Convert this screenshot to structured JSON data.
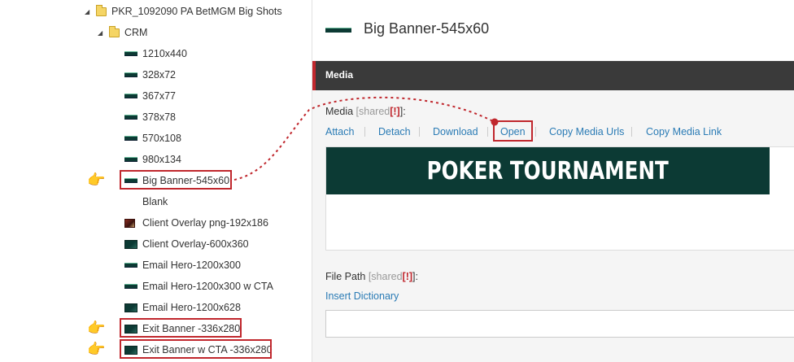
{
  "tree": {
    "root_folder": "PKR_1092090 PA BetMGM Big Shots",
    "sub_folder": "CRM",
    "items": [
      {
        "label": "1210x440",
        "thumb": "strip"
      },
      {
        "label": "328x72",
        "thumb": "strip"
      },
      {
        "label": "367x77",
        "thumb": "strip"
      },
      {
        "label": "378x78",
        "thumb": "strip"
      },
      {
        "label": "570x108",
        "thumb": "strip"
      },
      {
        "label": "980x134",
        "thumb": "strip"
      },
      {
        "label": "Big Banner-545x60",
        "thumb": "strip",
        "highlighted": true
      },
      {
        "label": "Blank",
        "thumb": "none"
      },
      {
        "label": "Client Overlay png-192x186",
        "thumb": "photo"
      },
      {
        "label": "Client Overlay-600x360",
        "thumb": "big"
      },
      {
        "label": "Email Hero-1200x300",
        "thumb": "strip"
      },
      {
        "label": "Email Hero-1200x300 w CTA",
        "thumb": "strip"
      },
      {
        "label": "Email Hero-1200x628",
        "thumb": "big"
      },
      {
        "label": "Exit Banner -336x280",
        "thumb": "big",
        "highlighted": true
      },
      {
        "label": "Exit Banner w CTA -336x280",
        "thumb": "big",
        "highlighted": true
      }
    ]
  },
  "header": {
    "title": "Big Banner-545x60"
  },
  "section": {
    "title": "Media"
  },
  "media_field": {
    "label": "Media",
    "shared": "[shared",
    "bang": "[!]",
    "close": "]:",
    "actions": [
      "Attach",
      "Detach",
      "Download",
      "Open",
      "Copy Media Urls",
      "Copy Media Link"
    ],
    "banner_text": "POKER TOURNAMENT"
  },
  "filepath_field": {
    "label": "File Path",
    "shared": "[shared",
    "bang": "[!]",
    "close": "]:",
    "link": "Insert Dictionary",
    "value": ""
  },
  "colors": {
    "accent_red": "#c0272d",
    "link_blue": "#2a7bb5",
    "banner_green": "#0c3a34",
    "section_bar": "#3a3a3a"
  }
}
